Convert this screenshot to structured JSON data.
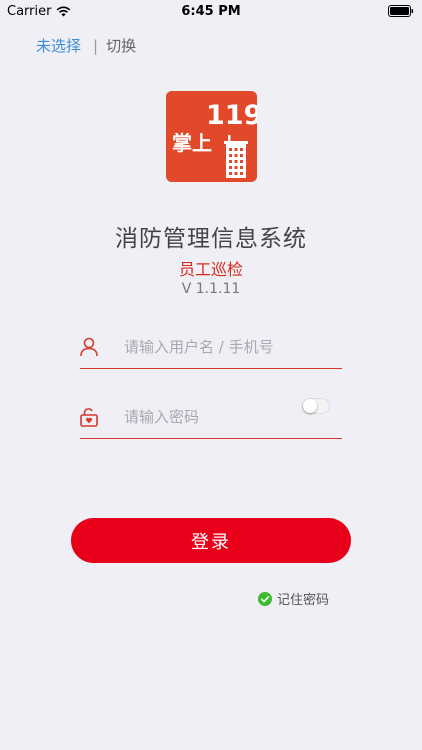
{
  "status_bar": {
    "carrier": "Carrier",
    "time": "6:45 PM"
  },
  "top_row": {
    "selection": "未选择",
    "divider": "|",
    "switch_label": "切换"
  },
  "logo": {
    "number": "119",
    "text": "掌上"
  },
  "header": {
    "title": "消防管理信息系统",
    "subtitle": "员工巡检",
    "version": "V 1.1.11"
  },
  "form": {
    "username_placeholder": "请输入用户名 / 手机号",
    "password_placeholder": "请输入密码",
    "login_label": "登录",
    "remember_label": "记住密码"
  },
  "colors": {
    "accent_red": "#e8001b",
    "subtitle_red": "#d42a20",
    "link_blue": "#3b8fd9",
    "logo_orange": "#e2492a",
    "check_green": "#3dbb2f"
  },
  "icons": [
    "wifi-icon",
    "battery-icon",
    "user-icon",
    "lock-icon",
    "check-icon"
  ]
}
